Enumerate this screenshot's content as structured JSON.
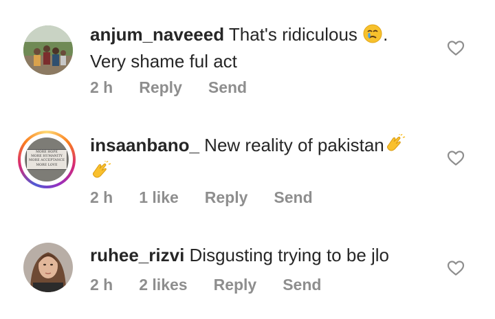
{
  "comments": [
    {
      "username": "anjum_naveeed",
      "text_line1": "That's ridiculous",
      "text_after_emoji": ".",
      "text_line2": "Very shame ful act",
      "emoji": "crying-face",
      "time": "2 h",
      "reply_label": "Reply",
      "send_label": "Send"
    },
    {
      "username": "insaanbano_",
      "text_line1": "New reality of pakistan",
      "emoji": "clapping-hands",
      "avatar_quote": [
        "MORE HOPE",
        "MORE HUMANITY",
        "MORE ACCEPTANCE",
        "MORE LOVE"
      ],
      "time": "2 h",
      "likes": "1 like",
      "reply_label": "Reply",
      "send_label": "Send"
    },
    {
      "username": "ruhee_rizvi",
      "text_line1": "Disgusting trying to be jlo",
      "time": "2 h",
      "likes": "2 likes",
      "reply_label": "Reply",
      "send_label": "Send"
    }
  ],
  "colors": {
    "text": "#262626",
    "meta": "#8e8e8e",
    "heart_stroke": "#8e8e8e"
  },
  "icons": [
    "heart-outline-icon",
    "crying-face-emoji",
    "clapping-hands-emoji"
  ]
}
